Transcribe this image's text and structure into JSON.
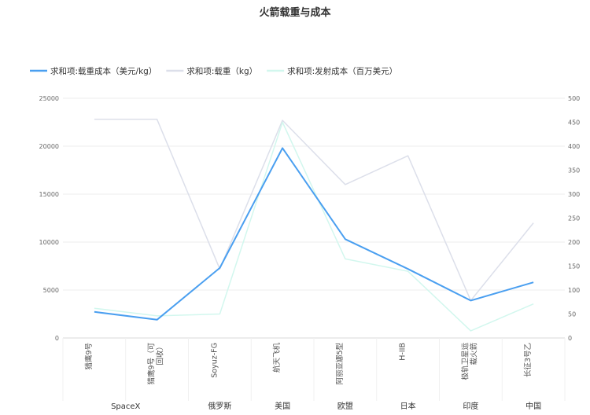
{
  "chart_data": {
    "type": "line",
    "title": "火箭载重与成本",
    "categories": [
      "猎鹰9号",
      "猎鹰9号（可回收）",
      "Soyuz-FG",
      "航天飞机",
      "阿丽亚娜5型",
      "H-IIB",
      "极轨卫星运载火箭",
      "长征3号乙"
    ],
    "category_lines": [
      [
        "猎鹰9号"
      ],
      [
        "猎鹰9号（可",
        "回收）"
      ],
      [
        "Soyuz-FG"
      ],
      [
        "航天飞机"
      ],
      [
        "阿丽亚娜5型"
      ],
      [
        "H-IIB"
      ],
      [
        "极轨卫星运",
        "载火箭"
      ],
      [
        "长征3号乙"
      ]
    ],
    "groups": [
      {
        "label": "SpaceX",
        "span": [
          0,
          1
        ]
      },
      {
        "label": "俄罗斯",
        "span": [
          2,
          2
        ]
      },
      {
        "label": "美国",
        "span": [
          3,
          3
        ]
      },
      {
        "label": "欧盟",
        "span": [
          4,
          4
        ]
      },
      {
        "label": "日本",
        "span": [
          5,
          5
        ]
      },
      {
        "label": "印度",
        "span": [
          6,
          6
        ]
      },
      {
        "label": "中国",
        "span": [
          7,
          7
        ]
      }
    ],
    "y_left": {
      "min": 0,
      "max": 25000,
      "ticks": [
        0,
        5000,
        10000,
        15000,
        20000,
        25000
      ]
    },
    "y_right": {
      "min": 0,
      "max": 500,
      "ticks": [
        0,
        50,
        100,
        150,
        200,
        250,
        300,
        350,
        400,
        450,
        500
      ]
    },
    "legend_position": "top-left",
    "grid": true,
    "series": [
      {
        "name": "求和项:载重成本（美元/kg）",
        "axis": "left",
        "color": "#4a9ff0",
        "width": 2,
        "values": [
          2720,
          1900,
          7300,
          19800,
          10300,
          7200,
          3900,
          5800
        ]
      },
      {
        "name": "求和项:载重（kg）",
        "axis": "left",
        "color": "#dcdfea",
        "width": 1.5,
        "values": [
          22800,
          22800,
          7200,
          22700,
          16000,
          19000,
          3900,
          12000
        ]
      },
      {
        "name": "求和项:发射成本（百万美元）",
        "axis": "right",
        "color": "#d2f7ee",
        "width": 1.5,
        "values": [
          62,
          46,
          50,
          450,
          165,
          139,
          15,
          71
        ]
      }
    ]
  }
}
